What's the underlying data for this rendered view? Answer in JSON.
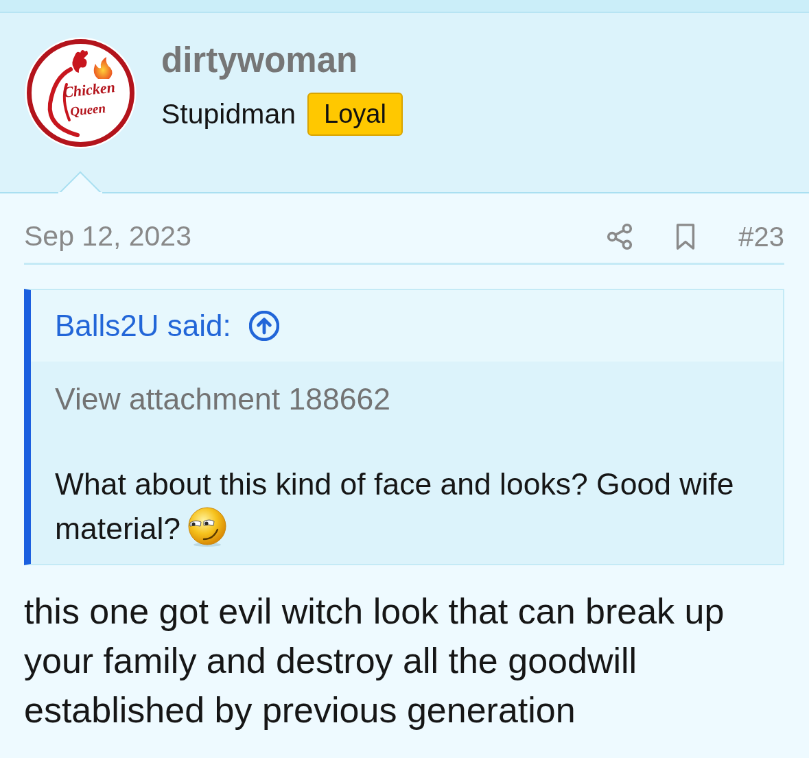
{
  "post": {
    "author": {
      "avatar_text": [
        "Chicken",
        "Queen"
      ],
      "username": "dirtywoman",
      "user_title": "Stupidman",
      "badge": "Loyal"
    },
    "date": "Sep 12, 2023",
    "post_number": "#23",
    "quote": {
      "attribution": "Balls2U said:",
      "paragraphs": [
        {
          "kind": "attachment",
          "text": "View attachment 188662",
          "smiley": false
        },
        {
          "kind": "text",
          "text": "What about this kind of face and looks? Good wife material?",
          "smiley": true
        }
      ]
    },
    "message": "this one got evil witch look that can break up your family and destroy all the goodwill established by previous generation"
  }
}
